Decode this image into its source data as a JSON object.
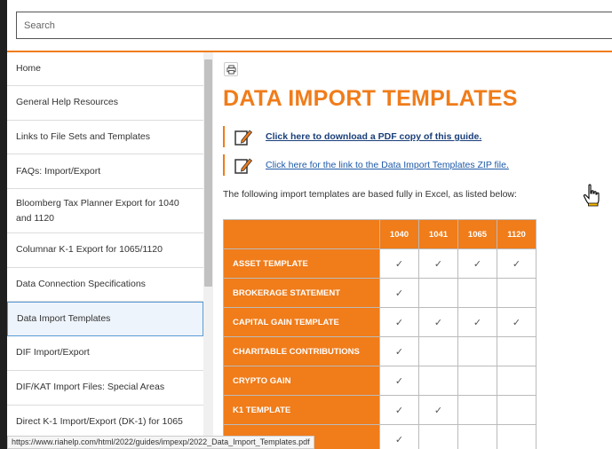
{
  "search": {
    "placeholder": "Search"
  },
  "sidebar": {
    "items": [
      {
        "label": "Home"
      },
      {
        "label": "General Help Resources"
      },
      {
        "label": "Links to File Sets and Templates"
      },
      {
        "label": "FAQs: Import/Export"
      },
      {
        "label": "Bloomberg Tax Planner Export for 1040 and 1120"
      },
      {
        "label": "Columnar K-1 Export for 1065/1120"
      },
      {
        "label": "Data Connection Specifications"
      },
      {
        "label": "Data Import Templates"
      },
      {
        "label": "DIF Import/Export"
      },
      {
        "label": "DIF/KAT Import Files: Special Areas"
      },
      {
        "label": "Direct K-1 Import/Export (DK-1) for 1065"
      }
    ],
    "active_index": 7
  },
  "status_bar": {
    "url": "https://www.riahelp.com/html/2022/guides/impexp/2022_Data_Import_Templates.pdf"
  },
  "main": {
    "title": "DATA IMPORT TEMPLATES",
    "link_pdf": "Click here to download a PDF copy of this guide.",
    "link_zip": "Click here for the link to the Data Import Templates ZIP file.",
    "intro": "The following import templates are based fully in Excel, as listed below:"
  },
  "table": {
    "columns": [
      "1040",
      "1041",
      "1065",
      "1120"
    ],
    "check_glyph": "✓",
    "rows": [
      {
        "name": "ASSET TEMPLATE",
        "checks": [
          true,
          true,
          true,
          true
        ]
      },
      {
        "name": "BROKERAGE STATEMENT",
        "checks": [
          true,
          false,
          false,
          false
        ]
      },
      {
        "name": "CAPITAL GAIN TEMPLATE",
        "checks": [
          true,
          true,
          true,
          true
        ]
      },
      {
        "name": "CHARITABLE CONTRIBUTIONS",
        "checks": [
          true,
          false,
          false,
          false
        ]
      },
      {
        "name": "CRYPTO GAIN",
        "checks": [
          true,
          false,
          false,
          false
        ]
      },
      {
        "name": "K1 TEMPLATE",
        "checks": [
          true,
          true,
          false,
          false
        ]
      },
      {
        "name": "",
        "checks": [
          true,
          false,
          false,
          false
        ]
      }
    ]
  },
  "colors": {
    "accent": "#f07c1a",
    "link": "#1e5aa8"
  }
}
